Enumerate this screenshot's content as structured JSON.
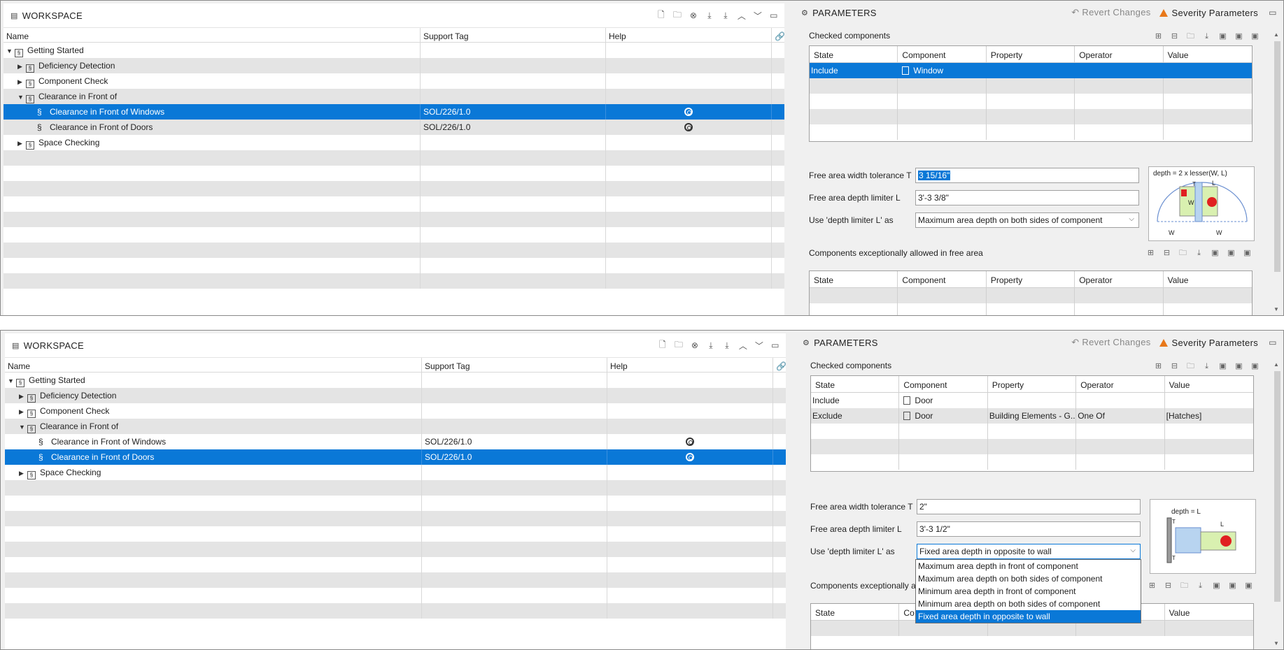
{
  "workspace": {
    "title": "WORKSPACE",
    "columns": [
      "Name",
      "Support Tag",
      "Help"
    ],
    "toolbar_icons": [
      "new-ruleset-icon",
      "open-folder-icon",
      "close-icon",
      "download-icon",
      "download-all-icon",
      "move-up-icon",
      "move-down-icon",
      "maximize-icon"
    ]
  },
  "parameters": {
    "title": "PARAMETERS",
    "revert_label": "Revert Changes",
    "severity_label": "Severity Parameters",
    "checked_components_label": "Checked components",
    "exceptions_label": "Components exceptionally allowed in free area",
    "grid_columns": [
      "State",
      "Component",
      "Property",
      "Operator",
      "Value"
    ],
    "width_tolerance_label": "Free area width tolerance T",
    "depth_limiter_label": "Free area depth limiter L",
    "use_depth_label": "Use 'depth limiter L' as"
  },
  "pane1": {
    "tree": [
      {
        "label": "Getting Started",
        "level": 0,
        "expand": "▼",
        "icon": "folder",
        "tag": "",
        "help": false,
        "selected": false
      },
      {
        "label": "Deficiency Detection",
        "level": 1,
        "expand": "▶",
        "icon": "folder",
        "tag": "",
        "help": false,
        "selected": false
      },
      {
        "label": "Component Check",
        "level": 1,
        "expand": "▶",
        "icon": "folder",
        "tag": "",
        "help": false,
        "selected": false
      },
      {
        "label": "Clearance  in Front of",
        "level": 1,
        "expand": "▼",
        "icon": "folder",
        "tag": "",
        "help": false,
        "selected": false
      },
      {
        "label": "Clearance in Front of Windows",
        "level": 2,
        "expand": "",
        "icon": "rule",
        "tag": "SOL/226/1.0",
        "help": true,
        "selected": true
      },
      {
        "label": "Clearance in Front of Doors",
        "level": 2,
        "expand": "",
        "icon": "rule",
        "tag": "SOL/226/1.0",
        "help": true,
        "selected": false
      },
      {
        "label": "Space Checking",
        "level": 1,
        "expand": "▶",
        "icon": "folder",
        "tag": "",
        "help": false,
        "selected": false
      }
    ],
    "checked_rows": [
      {
        "state": "Include",
        "component": "Window",
        "property": "",
        "operator": "",
        "value": "",
        "selected": true
      }
    ],
    "width_tolerance": "3 15/16\"",
    "depth_limiter": "3'-3 3/8\"",
    "use_depth": "Maximum area depth on both sides of component",
    "diagram_caption": "depth = 2 x lesser(W, L)",
    "diagram_labels": {
      "w": "W",
      "l": "L",
      "t": "T"
    }
  },
  "pane2": {
    "tree": [
      {
        "label": "Getting Started",
        "level": 0,
        "expand": "▼",
        "icon": "folder",
        "tag": "",
        "help": false,
        "selected": false
      },
      {
        "label": "Deficiency Detection",
        "level": 1,
        "expand": "▶",
        "icon": "folder",
        "tag": "",
        "help": false,
        "selected": false
      },
      {
        "label": "Component Check",
        "level": 1,
        "expand": "▶",
        "icon": "folder",
        "tag": "",
        "help": false,
        "selected": false
      },
      {
        "label": "Clearance  in Front of",
        "level": 1,
        "expand": "▼",
        "icon": "folder",
        "tag": "",
        "help": false,
        "selected": false
      },
      {
        "label": "Clearance in Front of Windows",
        "level": 2,
        "expand": "",
        "icon": "rule",
        "tag": "SOL/226/1.0",
        "help": true,
        "selected": false
      },
      {
        "label": "Clearance in Front of Doors",
        "level": 2,
        "expand": "",
        "icon": "rule",
        "tag": "SOL/226/1.0",
        "help": true,
        "selected": true
      },
      {
        "label": "Space Checking",
        "level": 1,
        "expand": "▶",
        "icon": "folder",
        "tag": "",
        "help": false,
        "selected": false
      }
    ],
    "checked_rows": [
      {
        "state": "Include",
        "component": "Door",
        "property": "",
        "operator": "",
        "value": "",
        "selected": false
      },
      {
        "state": "Exclude",
        "component": "Door",
        "property": "Building Elements - G...",
        "operator": "One Of",
        "value": "[Hatches]",
        "selected": false
      }
    ],
    "width_tolerance": "2\"",
    "depth_limiter": "3'-3 1/2\"",
    "use_depth": "Fixed area depth in opposite to wall",
    "exceptions_label_partial": "Components exceptionally a",
    "exceptions_col2_partial": "Co",
    "diagram_caption": "depth = L",
    "diagram_labels": {
      "l": "L",
      "t": "T"
    },
    "dropdown_options": [
      {
        "label": "Maximum area depth in front of component",
        "selected": false
      },
      {
        "label": "Maximum area depth on both sides of component",
        "selected": false
      },
      {
        "label": "Minimum area depth in front of component",
        "selected": false
      },
      {
        "label": "Minimum area depth on both sides of component",
        "selected": false
      },
      {
        "label": "Fixed area depth in opposite to wall",
        "selected": true
      }
    ]
  },
  "colors": {
    "selection": "#0a78d7",
    "warning": "#e8781a",
    "diagram_red": "#e02020",
    "diagram_green": "#d9f0b0",
    "diagram_blue": "#b8d4f0"
  }
}
